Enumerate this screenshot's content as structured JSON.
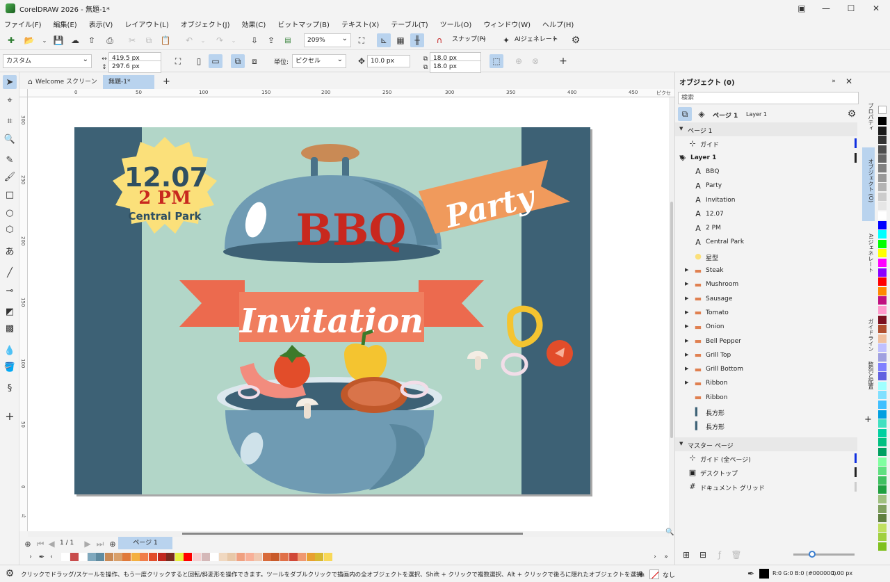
{
  "window": {
    "title": "CorelDRAW 2026 - 無題-1*"
  },
  "menu": [
    "ファイル(F)",
    "編集(E)",
    "表示(V)",
    "レイアウト(L)",
    "オブジェクト(J)",
    "効果(C)",
    "ビットマップ(B)",
    "テキスト(X)",
    "テーブル(T)",
    "ツール(O)",
    "ウィンドウ(W)",
    "ヘルプ(H)"
  ],
  "toolbar": {
    "zoom": "209%",
    "snap": "スナップ(P)",
    "ai": "AIジェネレート"
  },
  "propbar": {
    "preset": "カスタム",
    "width": "419.5 px",
    "height": "297.6 px",
    "units_label": "単位:",
    "units": "ピクセル",
    "nudge": "10.0 px",
    "dup_x": "18.0 px",
    "dup_y": "18.0 px"
  },
  "tabs": {
    "welcome": "Welcome スクリーン",
    "doc": "無題-1*"
  },
  "ruler": {
    "h": [
      "50",
      "0",
      "50",
      "100",
      "150",
      "200",
      "250",
      "300",
      "350",
      "400",
      "450"
    ],
    "h_unit": "ピクセル",
    "v": [
      "300",
      "250",
      "200",
      "150",
      "100",
      "50",
      "0"
    ],
    "v_unit": "ピクセル"
  },
  "artwork": {
    "date": "12.07",
    "time": "2 PM",
    "place": "Central Park",
    "bbq": "BBQ",
    "party": "Party",
    "invitation": "Invitation"
  },
  "pagenav": {
    "count": "1 / 1",
    "page_tab": "ページ 1"
  },
  "status": {
    "hint": "クリックでドラッグ/スケールを操作、もう一度クリックすると回転/斜変形を操作できます。ツールをダブルクリックで描画内の全オブジェクトを選択、Shift + クリックで複数選択、Alt + クリックで後ろに隠れたオブジェクトを選択。",
    "fill": "なし",
    "outline": "R:0 G:0 B:0 (#000000)",
    "outline_width": "1.00 px"
  },
  "docker": {
    "title": "オブジェクト (0)",
    "search_placeholder": "検索",
    "page_label": "ページ 1",
    "layer_label": "Layer 1",
    "rows": [
      {
        "label": "ページ 1",
        "icon": "page",
        "indent": 0,
        "header": true
      },
      {
        "label": "ガイド",
        "icon": "guides",
        "indent": 1
      },
      {
        "label": "Layer 1",
        "icon": "layer",
        "indent": 0,
        "bold": true
      },
      {
        "label": "BBQ",
        "icon": "text",
        "indent": 2
      },
      {
        "label": "Party",
        "icon": "text",
        "indent": 2
      },
      {
        "label": "Invitation",
        "icon": "text",
        "indent": 2
      },
      {
        "label": "12.07",
        "icon": "text",
        "indent": 2
      },
      {
        "label": "2 PM",
        "icon": "text",
        "indent": 2
      },
      {
        "label": "Central Park",
        "icon": "text",
        "indent": 2
      },
      {
        "label": "星型",
        "icon": "star",
        "indent": 2
      },
      {
        "label": "Steak",
        "icon": "group",
        "indent": 2
      },
      {
        "label": "Mushroom",
        "icon": "group",
        "indent": 2
      },
      {
        "label": "Sausage",
        "icon": "group",
        "indent": 2
      },
      {
        "label": "Tomato",
        "icon": "group",
        "indent": 2
      },
      {
        "label": "Onion",
        "icon": "group",
        "indent": 2
      },
      {
        "label": "Bell Pepper",
        "icon": "group",
        "indent": 2
      },
      {
        "label": "Grill Top",
        "icon": "group",
        "indent": 2
      },
      {
        "label": "Grill Bottom",
        "icon": "group",
        "indent": 2
      },
      {
        "label": "Ribbon",
        "icon": "group",
        "indent": 2
      },
      {
        "label": "Ribbon",
        "icon": "curve",
        "indent": 2
      },
      {
        "label": "長方形",
        "icon": "rect",
        "indent": 2
      },
      {
        "label": "長方形",
        "icon": "rect",
        "indent": 2
      },
      {
        "label": "マスター ページ",
        "icon": "master",
        "indent": 0,
        "header": true
      },
      {
        "label": "ガイド (全ページ)",
        "icon": "guides",
        "indent": 1
      },
      {
        "label": "デスクトップ",
        "icon": "desktop",
        "indent": 1
      },
      {
        "label": "ドキュメント グリッド",
        "icon": "grid",
        "indent": 1
      }
    ],
    "vtabs": [
      "プロパティ",
      "オブジェクト (O)",
      "AIジェネレート",
      "ガイドライン",
      "整列と配置"
    ]
  },
  "colors": {
    "accent": "#b9d3ee",
    "bg_navy": "#3d6175",
    "bg_mint": "#b2d6c8",
    "red": "#c8281e",
    "orange": "#f09a5c",
    "coral": "#ec6a4e",
    "yellow": "#fbe07a",
    "grill_blue": "#6f9bb3"
  },
  "palette_bottom": [
    "#ffffff",
    "#c84c4c",
    "#ffffff",
    "#7fa8bd",
    "#5f8ba0",
    "#c98a55",
    "#d9a06a",
    "#e07a3a",
    "#f4b040",
    "#f07e4a",
    "#e24d2a",
    "#c0281e",
    "#7a2a1e",
    "#e8f040",
    "#ff0000",
    "#f5d0d0",
    "#d4b8b8",
    "#ffffff",
    "#f0d8c0",
    "#e8c8a8",
    "#f0a080",
    "#f8b098",
    "#f0c8b0",
    "#d86a3a",
    "#c85a2a",
    "#e07048",
    "#d04838",
    "#f09870",
    "#e8a030",
    "#d8b830",
    "#f8d858"
  ],
  "palette_right": [
    "#000000",
    "#1a1a1a",
    "#333333",
    "#4d4d4d",
    "#666666",
    "#808080",
    "#999999",
    "#b3b3b3",
    "#cccccc",
    "#e6e6e6",
    "#ffffff",
    "#0000ff",
    "#00ffff",
    "#00ff00",
    "#ffff00",
    "#ff00ff",
    "#8b00ff",
    "#ff0000",
    "#ff8800",
    "#c01080",
    "#ff99cc",
    "#7a1020",
    "#b05030",
    "#f0c0a0",
    "#c0c0ff",
    "#a0a0e0",
    "#8080ff",
    "#6060e0",
    "#a0ffff",
    "#80e0ff",
    "#40c0ff",
    "#00a0e0",
    "#40e0c0",
    "#00d0a0",
    "#00c080",
    "#00a060",
    "#80ffa0",
    "#60e080",
    "#40c060",
    "#20a040",
    "#a0c080",
    "#80a060",
    "#608040",
    "#c0e060",
    "#a0d040",
    "#80c020"
  ]
}
